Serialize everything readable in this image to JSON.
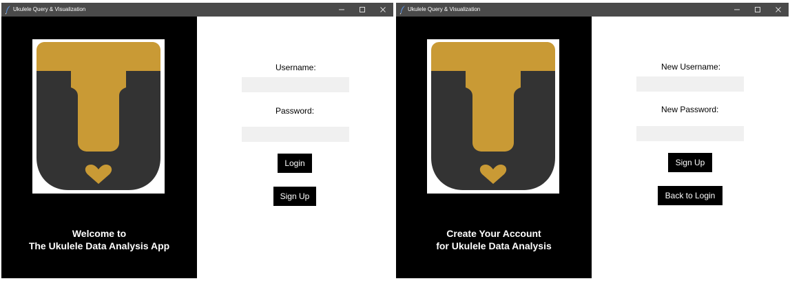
{
  "windows": [
    {
      "title": "Ukulele Query & Visualization",
      "welcome": [
        "Welcome to",
        "The Ukulele Data Analysis App"
      ],
      "form": {
        "username_label": "Username:",
        "username_value": "",
        "password_label": "Password:",
        "password_value": "",
        "primary_button": "Login",
        "secondary_button": "Sign Up"
      }
    },
    {
      "title": "Ukulele Query & Visualization",
      "welcome": [
        "Create Your Account",
        "for Ukulele Data Analysis"
      ],
      "form": {
        "username_label": "New Username:",
        "username_value": "",
        "password_label": "New Password:",
        "password_value": "",
        "primary_button": "Sign Up",
        "secondary_button": "Back to Login"
      }
    }
  ],
  "colors": {
    "titlebar": "#4a4a4a",
    "panel": "#000000",
    "logo_gold": "#c99a35",
    "logo_dark": "#333333",
    "field_bg": "#f0f0f0",
    "button_bg": "#000000"
  },
  "icons": [
    "feather-icon",
    "minimize-icon",
    "maximize-icon",
    "close-icon",
    "tiki-logo"
  ]
}
